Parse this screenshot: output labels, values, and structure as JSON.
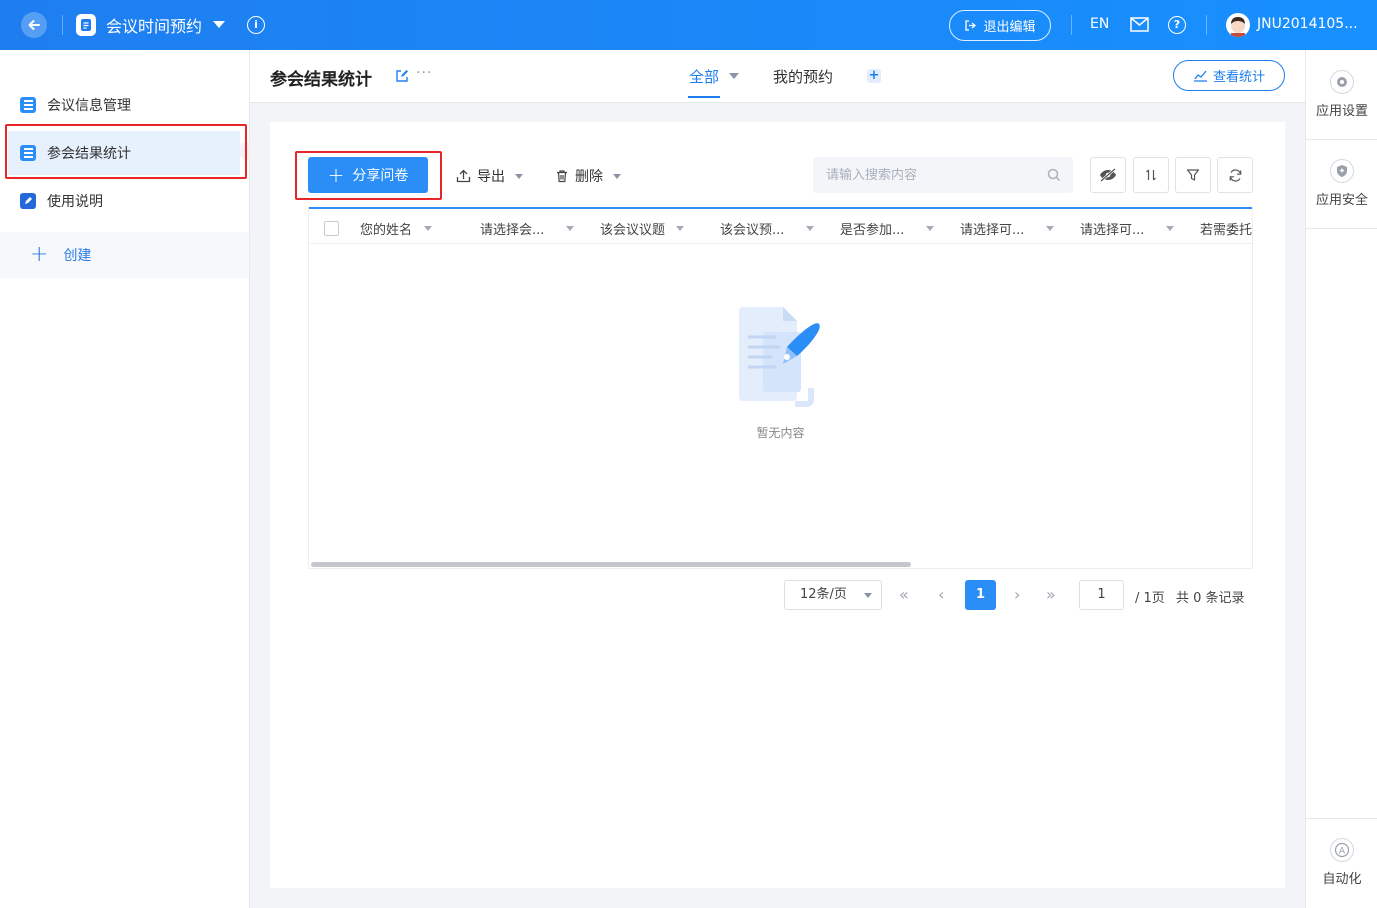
{
  "topbar": {
    "app_title": "会议时间预约",
    "exit_edit": "退出编辑",
    "lang": "EN",
    "username": "JNU2014105..."
  },
  "sidebar": {
    "items": [
      {
        "label": "会议信息管理"
      },
      {
        "label": "参会结果统计"
      },
      {
        "label": "使用说明"
      }
    ],
    "create_label": "创建"
  },
  "header": {
    "title": "参会结果统计",
    "more": "···",
    "tabs": [
      {
        "label": "全部"
      },
      {
        "label": "我的预约"
      }
    ],
    "stats_button": "查看统计"
  },
  "toolbar": {
    "share_label": "分享问卷",
    "export_label": "导出",
    "delete_label": "删除",
    "search_placeholder": "请输入搜索内容"
  },
  "table": {
    "columns": [
      "您的姓名",
      "请选择会...",
      "该会议议题",
      "该会议预...",
      "是否参加...",
      "请选择可...",
      "请选择可...",
      "若需委托"
    ],
    "empty_text": "暂无内容"
  },
  "pagination": {
    "page_size": "12条/页",
    "current_page": "1",
    "jump_value": "1",
    "total_pages": "/ 1页",
    "total_records": "共 0 条记录"
  },
  "rightbar": {
    "items": [
      {
        "label": "应用设置"
      },
      {
        "label": "应用安全"
      },
      {
        "label": "自动化"
      }
    ]
  },
  "colors": {
    "brand": "#1e7ef0",
    "primary_button": "#2b8ef7",
    "highlight_border": "#e8262a"
  }
}
